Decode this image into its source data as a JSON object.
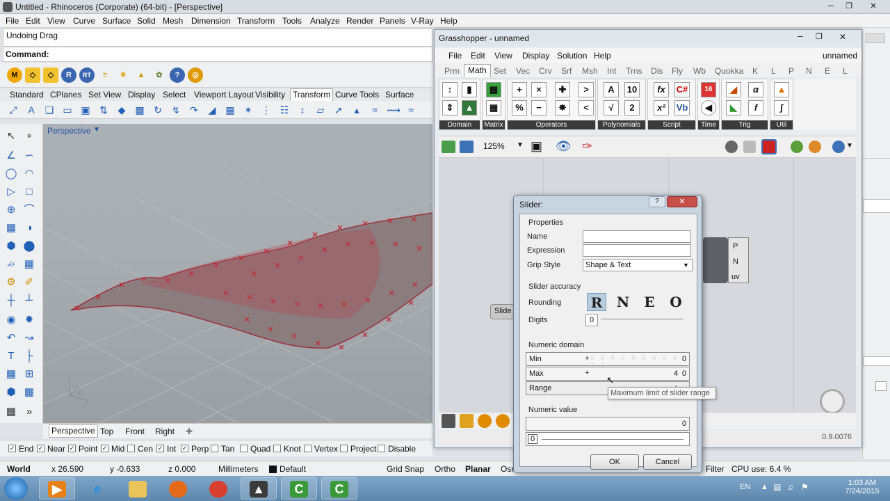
{
  "rhino": {
    "title": "Untitled - Rhinoceros (Corporate) (64-bit) - [Perspective]",
    "menu": [
      "File",
      "Edit",
      "View",
      "Curve",
      "Surface",
      "Solid",
      "Mesh",
      "Dimension",
      "Transform",
      "Tools",
      "Analyze",
      "Render",
      "Panels",
      "V-Ray",
      "Help"
    ],
    "history": "Undoing Drag",
    "command_label": "Command:",
    "toolbar_tabs": [
      "Standard",
      "CPlanes",
      "Set View",
      "Display",
      "Select",
      "Viewport Layout",
      "Visibility",
      "Transform",
      "Curve Tools",
      "Surface Tools"
    ],
    "active_tab": "Transform",
    "viewport_label": "Perspective",
    "viewport_tabs": [
      "Perspective",
      "Top",
      "Front",
      "Right"
    ],
    "osnap": [
      {
        "label": "End",
        "checked": true
      },
      {
        "label": "Near",
        "checked": true
      },
      {
        "label": "Point",
        "checked": true
      },
      {
        "label": "Mid",
        "checked": true
      },
      {
        "label": "Cen",
        "checked": false
      },
      {
        "label": "Int",
        "checked": true
      },
      {
        "label": "Perp",
        "checked": true
      },
      {
        "label": "Tan",
        "checked": false
      },
      {
        "label": "Quad",
        "checked": false
      },
      {
        "label": "Knot",
        "checked": false
      },
      {
        "label": "Vertex",
        "checked": false
      },
      {
        "label": "Project",
        "checked": false
      },
      {
        "label": "Disable",
        "checked": false
      }
    ],
    "status": {
      "cplane": "World",
      "x": "x 26.590",
      "y": "y -0.633",
      "z": "z 0.000",
      "units": "Millimeters",
      "layer": "Default",
      "grid_snap": "Grid Snap",
      "ortho": "Ortho",
      "planar": "Planar",
      "osnap_short": "Osr",
      "filter": "Filter",
      "cpu": "CPU use: 6.4 %"
    }
  },
  "gh": {
    "title": "Grasshopper - unnamed",
    "doc_name": "unnamed",
    "menu": [
      "File",
      "Edit",
      "View",
      "Display",
      "Solution",
      "Help"
    ],
    "tabs": [
      "Prm",
      "Math",
      "Set",
      "Vec",
      "Crv",
      "Srf",
      "Msh",
      "Int",
      "Trns",
      "Dis",
      "Fly",
      "Wb",
      "Quokka",
      "K",
      "L",
      "P",
      "N",
      "E",
      "L"
    ],
    "active_tab": "Math",
    "groups": [
      "Domain",
      "Matrix",
      "Operators",
      "Polynomials",
      "Script",
      "Time",
      "Trig",
      "Util"
    ],
    "zoom": "125%",
    "version": "0.9.0076",
    "node_outputs": [
      "P",
      "N",
      "uv"
    ],
    "slider_node_label": "Slide"
  },
  "dialog": {
    "title": "Slider:",
    "properties_label": "Properties",
    "name_label": "Name",
    "name_value": "",
    "expression_label": "Expression",
    "expression_value": "",
    "grip_style_label": "Grip Style",
    "grip_style_value": "Shape & Text",
    "accuracy_label": "Slider accuracy",
    "rounding_label": "Rounding",
    "rounding_options": [
      "R",
      "N",
      "E",
      "O"
    ],
    "rounding_selected": "R",
    "digits_label": "Digits",
    "digits_value": "0",
    "domain_label": "Numeric domain",
    "min_label": "Min",
    "min_value": "0",
    "max_label": "Max",
    "max_value": "4",
    "range_label": "Range",
    "range_value": "4",
    "tooltip": "Maximum limit of slider range",
    "numeric_value_label": "Numeric value",
    "numeric_value": "0",
    "slider_value": "0",
    "ok": "OK",
    "cancel": "Cancel"
  },
  "taskbar": {
    "language": "EN",
    "time": "1:03 AM",
    "date": "7/24/2015"
  }
}
